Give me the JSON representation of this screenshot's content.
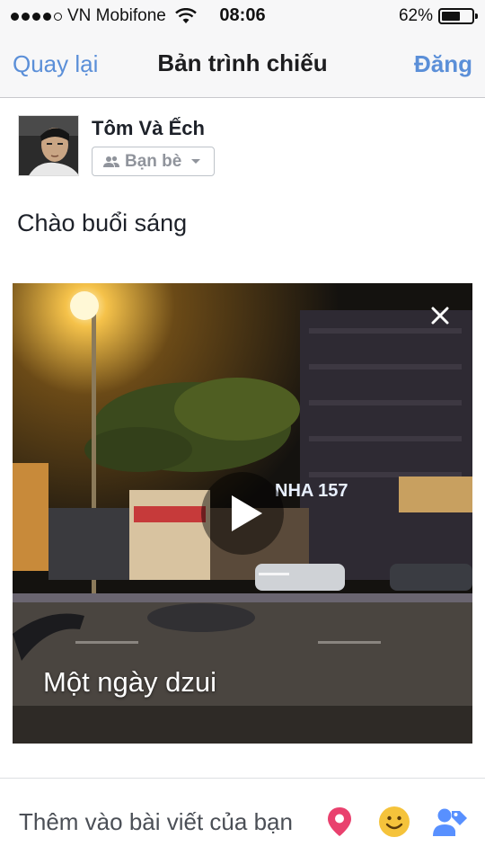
{
  "status_bar": {
    "carrier": "VN Mobifone",
    "time": "08:06",
    "battery_percent_label": "62%",
    "battery_level": 0.62,
    "signal_bars_filled": 4,
    "signal_bars_total": 5
  },
  "nav": {
    "back_label": "Quay lại",
    "title": "Bản trình chiếu",
    "post_label": "Đăng",
    "accent_color": "#5b8fd8"
  },
  "composer": {
    "user_name": "Tôm Và Ếch",
    "audience_label": "Bạn bè",
    "post_text": "Chào buổi sáng"
  },
  "media": {
    "caption": "Một ngày dzui",
    "storefront_sign": "NHA 157",
    "close_icon": "close-icon",
    "play_icon": "play-icon"
  },
  "add_to_post": {
    "label": "Thêm vào bài viết của bạn",
    "icons": [
      {
        "name": "location-pin-icon",
        "color": "#e9416e"
      },
      {
        "name": "emoji-smile-icon",
        "color": "#f5c33b"
      },
      {
        "name": "tag-friends-icon",
        "color": "#5890ff"
      }
    ]
  }
}
